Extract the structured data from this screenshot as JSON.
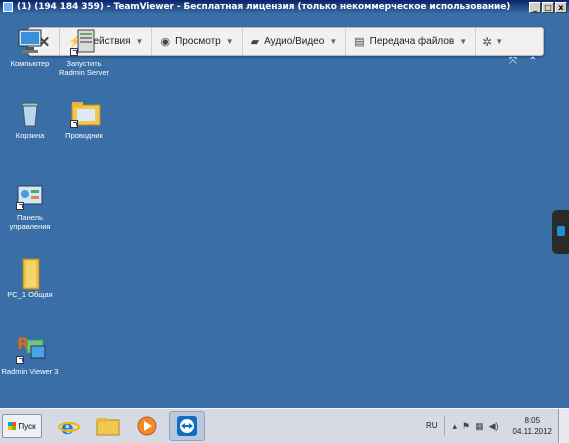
{
  "window": {
    "title": "(1) (194 184 359) - TeamViewer - Бесплатная лицензия (только некоммерческое использование)",
    "buttons": {
      "minimize": "_",
      "maximize": "□",
      "close": "x"
    }
  },
  "toolbar": {
    "close_label": "✕",
    "items": [
      {
        "label": "Действия",
        "icon": "lightning-icon"
      },
      {
        "label": "Просмотр",
        "icon": "eye-icon"
      },
      {
        "label": "Аудио/Видео",
        "icon": "chat-icon"
      },
      {
        "label": "Передача файлов",
        "icon": "file-transfer-icon"
      }
    ],
    "settings_icon": "gear-icon"
  },
  "desktop_icons": [
    {
      "label": "Компьютер",
      "icon": "computer-icon"
    },
    {
      "label": "Запустить Radmin Server",
      "icon": "radmin-server-icon"
    },
    {
      "label": "Корзина",
      "icon": "recycle-bin-icon"
    },
    {
      "label": "Проводник",
      "icon": "explorer-folder-icon"
    },
    {
      "label": "Панель управления",
      "icon": "control-panel-icon"
    },
    {
      "label": "PC_1 Общая",
      "icon": "shared-folder-icon"
    },
    {
      "label": "Radmin Viewer 3",
      "icon": "radmin-viewer-icon"
    }
  ],
  "taskbar": {
    "start_label": "Пуск",
    "apps": [
      "internet-explorer-icon",
      "file-explorer-icon",
      "media-player-icon",
      "teamviewer-icon"
    ],
    "language": "RU",
    "time": "8:05",
    "date": "04.11.2012"
  },
  "colors": {
    "desktop": "#3a6ea6",
    "titlebar": "#0a246a"
  }
}
